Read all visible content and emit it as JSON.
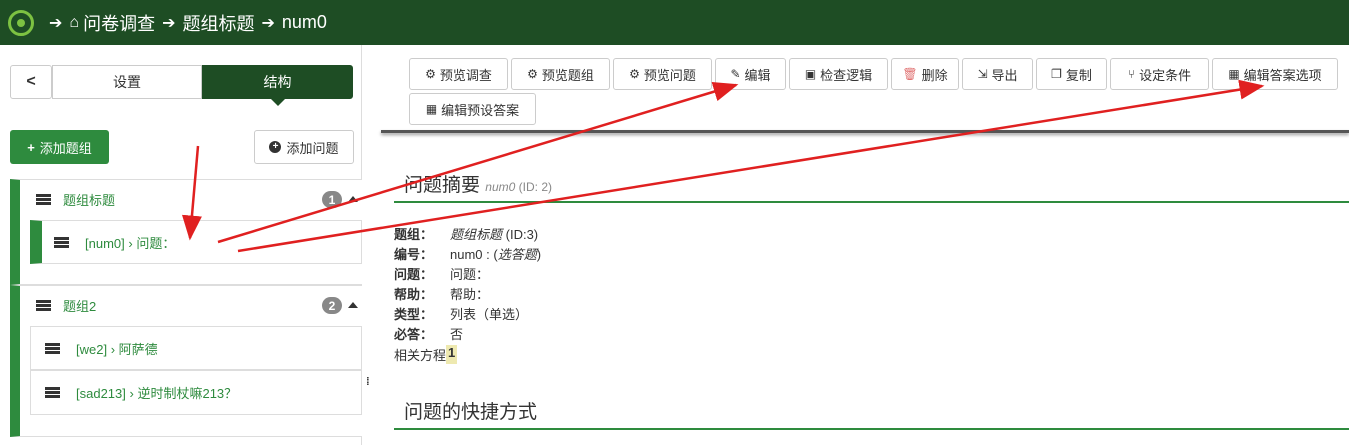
{
  "breadcrumb": {
    "items": [
      "问卷调查",
      "题组标题",
      "num0"
    ]
  },
  "sidebar": {
    "back_label": "<",
    "tabs": {
      "settings": "设置",
      "structure": "结构"
    },
    "add_group_label": "添加题组",
    "add_question_label": "添加问题",
    "groups": [
      {
        "title": "题组标题",
        "count": "1",
        "questions": [
          {
            "code": "[num0]",
            "sep": "›",
            "text": "问题："
          }
        ]
      },
      {
        "title": "题组2",
        "count": "2",
        "questions": [
          {
            "code": "[we2]",
            "sep": "›",
            "text": "阿萨德"
          },
          {
            "code": "[sad213]",
            "sep": "›",
            "text": "逆时制杖嘛213？"
          }
        ]
      }
    ],
    "resize_dots": "⁞"
  },
  "toolbar": {
    "preview_survey": "预览调查",
    "preview_group": "预览题组",
    "preview_question": "预览问题",
    "edit": "编辑",
    "check_logic": "检查逻辑",
    "delete": "删除",
    "export": "导出",
    "copy": "复制",
    "set_conditions": "设定条件",
    "edit_answer_options": "编辑答案选项",
    "edit_default_answers": "编辑预设答案"
  },
  "summary": {
    "title": "问题摘要",
    "code": "num0",
    "id": "(ID: 2)",
    "rows": {
      "group_label": "题组：",
      "group_value": "题组标题",
      "group_id": "(ID:3)",
      "code_label": "编号：",
      "code_value": "num0 : (",
      "code_type": "选答题",
      "code_close": ")",
      "question_label": "问题：",
      "question_value": "问题：",
      "help_label": "帮助：",
      "help_value": "帮助：",
      "type_label": "类型：",
      "type_value": "列表（单选）",
      "mandatory_label": "必答：",
      "mandatory_value": "否",
      "equation_label": "相关方程",
      "equation_value": "1"
    }
  },
  "shortcuts": {
    "title": "问题的快捷方式"
  },
  "colors": {
    "topbar": "#1e4d24",
    "accent": "#2e8b3e",
    "arrow": "#e02020"
  },
  "icons": {
    "home": "home-icon",
    "gear": "gear-icon",
    "pencil": "pencil-icon",
    "trash": "trash-icon"
  }
}
